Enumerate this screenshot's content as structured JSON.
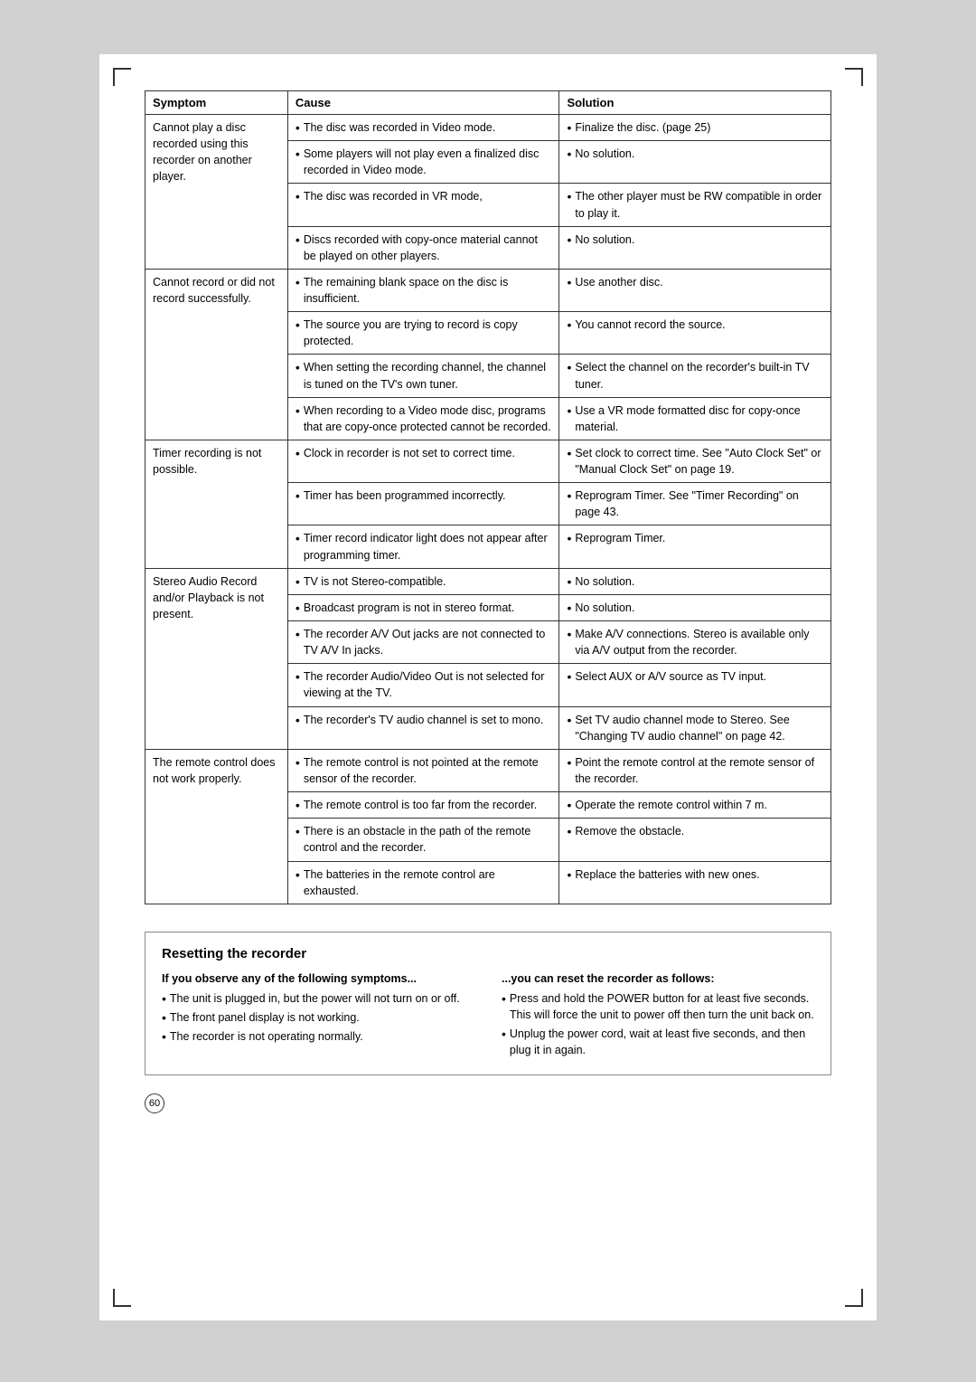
{
  "page": {
    "number": "60"
  },
  "table": {
    "headers": [
      "Symptom",
      "Cause",
      "Solution"
    ],
    "rows": [
      {
        "symptom": "Cannot play a disc recorded using this recorder on another player.",
        "causes": [
          "The disc was recorded in Video mode.",
          "Some players will not play even a finalized disc recorded in Video mode.",
          "The disc was recorded in VR mode,",
          "Discs recorded with copy-once material cannot be played on other players."
        ],
        "solutions": [
          "Finalize the disc. (page 25)",
          "No solution.",
          "The other player must be RW compatible in order to play it.",
          "No solution."
        ]
      },
      {
        "symptom": "Cannot record or did not record successfully.",
        "causes": [
          "The remaining blank space on the disc is insufficient.",
          "The source you are trying to record is copy protected.",
          "When setting the recording channel, the channel is tuned on the TV's own tuner.",
          "When recording to a Video mode disc, programs that are copy-once protected cannot be recorded."
        ],
        "solutions": [
          "Use another disc.",
          "You cannot record the source.",
          "Select the channel on the recorder's built-in TV tuner.",
          "Use a VR mode formatted disc for copy-once material."
        ]
      },
      {
        "symptom": "Timer recording is not possible.",
        "causes": [
          "Clock in recorder is not set to correct time.",
          "Timer has been programmed incorrectly.",
          "Timer record indicator light does not appear after programming timer."
        ],
        "solutions": [
          "Set clock to correct time. See \"Auto Clock Set\" or \"Manual Clock Set\" on page 19.",
          "Reprogram Timer. See \"Timer Recording\" on page 43.",
          "Reprogram Timer."
        ]
      },
      {
        "symptom": "Stereo Audio Record and/or Playback is not present.",
        "causes": [
          "TV is not Stereo-compatible.",
          "Broadcast program is not in stereo format.",
          "The recorder A/V Out jacks are not connected to TV A/V In jacks.",
          "The recorder Audio/Video Out is not selected for viewing at the TV.",
          "The recorder's TV audio channel is set to mono."
        ],
        "solutions": [
          "No solution.",
          "No solution.",
          "Make A/V connections. Stereo is available only via A/V output from the recorder.",
          "Select AUX or A/V source as TV input.",
          "Set TV audio channel mode to Stereo. See \"Changing TV audio channel\" on page 42."
        ]
      },
      {
        "symptom": "The remote control does not work properly.",
        "causes": [
          "The remote control is not pointed at the remote sensor of the recorder.",
          "The remote control is too far from the recorder.",
          "There is an obstacle in the path of the remote control and the recorder.",
          "The batteries in the remote control are exhausted."
        ],
        "solutions": [
          "Point the remote control at the remote sensor of the recorder.",
          "Operate the remote control within 7 m.",
          "Remove the obstacle.",
          "Replace the batteries with new ones."
        ]
      }
    ]
  },
  "resetting": {
    "title": "Resetting the recorder",
    "left_subtitle": "If you observe any of the following symptoms...",
    "left_bullets": [
      "The unit is plugged in, but the power will not turn on or off.",
      "The front panel display is not working.",
      "The recorder is not operating normally."
    ],
    "right_subtitle": "...you can reset the recorder as follows:",
    "right_bullets": [
      "Press and hold the POWER button for at least five seconds. This will force the unit to power off then turn the unit back on.",
      "Unplug the power cord, wait at least five seconds, and then plug it in again."
    ]
  }
}
